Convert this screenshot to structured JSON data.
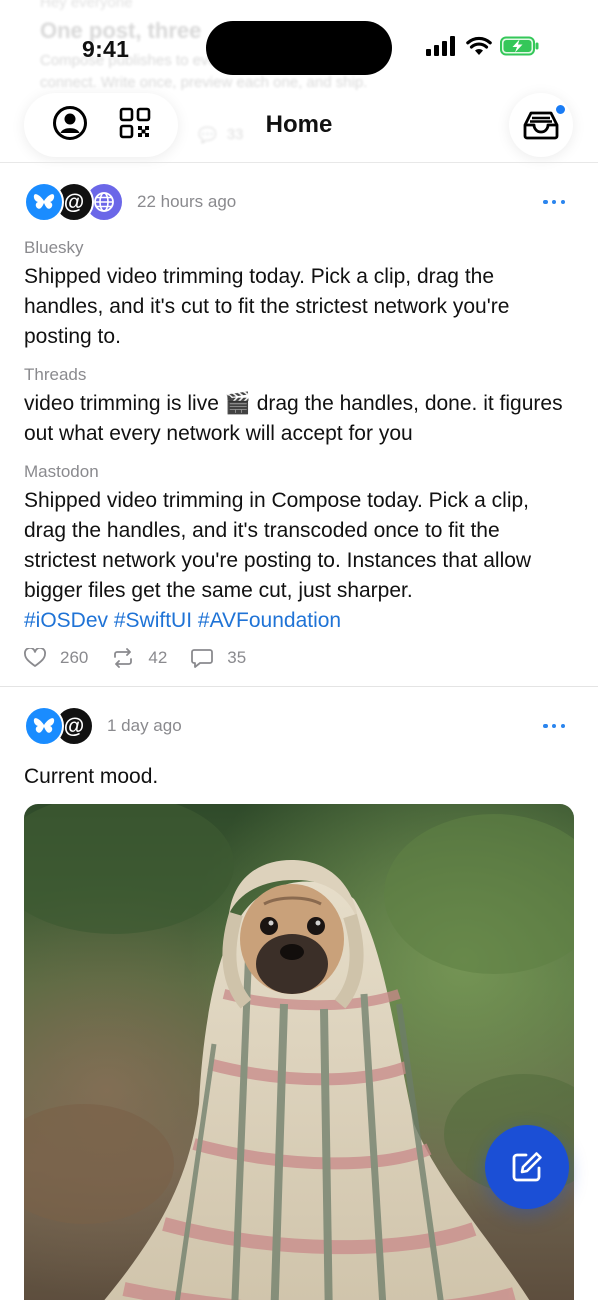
{
  "status_bar": {
    "time": "9:41"
  },
  "behind_content": {
    "small": "Hey everyone",
    "title": "One post, three",
    "text": "Compose publishes to every network you connect. Write once, preview each one, and ship.",
    "reply_count": "33"
  },
  "header": {
    "title": "Home"
  },
  "colors": {
    "accent": "#1b4fd6",
    "link": "#1f73d6",
    "bluesky": "#1a8cff",
    "mastodon": "#6b67e8",
    "notification_dot": "#1a7cf5"
  },
  "posts": [
    {
      "timestamp": "22 hours ago",
      "networks": [
        "bluesky",
        "threads",
        "mastodon"
      ],
      "variants": [
        {
          "network": "Bluesky",
          "text": "Shipped video trimming today. Pick a clip, drag the handles, and it's cut to fit the strictest network you're posting to."
        },
        {
          "network": "Threads",
          "text": "video trimming is live 🎬 drag the handles, done. it figures out what every network will accept for you"
        },
        {
          "network": "Mastodon",
          "text": "Shipped video trimming in Compose today. Pick a clip, drag the handles, and it's transcoded once to fit the strictest network you're posting to. Instances that allow bigger files get the same cut, just sharper.",
          "hashtags": "#iOSDev #SwiftUI #AVFoundation"
        }
      ],
      "likes": "260",
      "reposts": "42",
      "replies": "35"
    },
    {
      "timestamp": "1 day ago",
      "networks": [
        "bluesky",
        "threads"
      ],
      "text": "Current mood.",
      "image": "pug-wrapped-in-plaid-blanket"
    }
  ],
  "icons": {
    "profile": "person-circle-icon",
    "qr": "qr-code-icon",
    "inbox": "inbox-tray-icon",
    "compose": "compose-icon",
    "like": "heart-icon",
    "repost": "repost-icon",
    "reply": "reply-bubble-icon",
    "more": "ellipsis-icon"
  }
}
